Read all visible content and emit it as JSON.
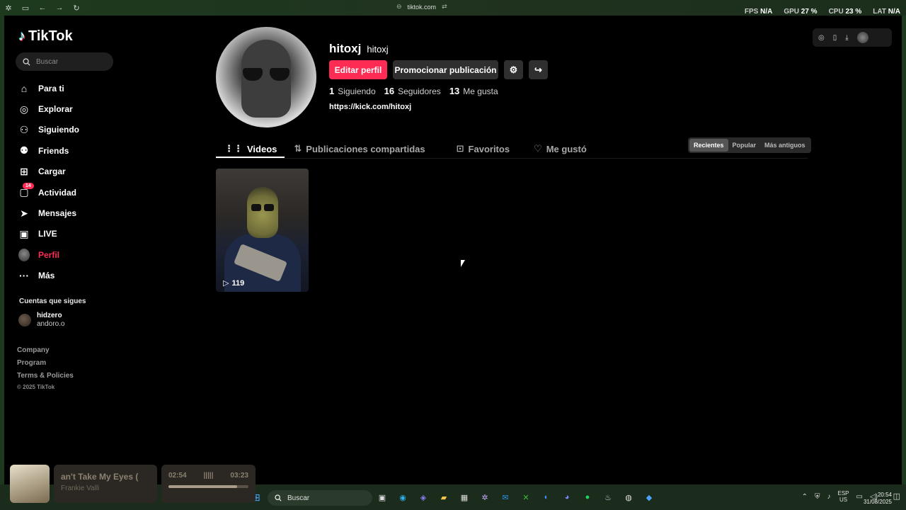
{
  "browser": {
    "url": "tiktok.com"
  },
  "overlay": {
    "fps_label": "FPS",
    "fps_value": "N/A",
    "gpu_label": "GPU",
    "gpu_value": "27 %",
    "cpu_label": "CPU",
    "cpu_value": "23 %",
    "lat_label": "LAT",
    "lat_value": "N/A"
  },
  "sidebar": {
    "logo": "TikTok",
    "search_placeholder": "Buscar",
    "items": [
      {
        "label": "Para ti",
        "icon": "home-icon"
      },
      {
        "label": "Explorar",
        "icon": "compass-icon"
      },
      {
        "label": "Siguiendo",
        "icon": "following-icon"
      },
      {
        "label": "Friends",
        "icon": "friends-icon"
      },
      {
        "label": "Cargar",
        "icon": "upload-icon"
      },
      {
        "label": "Actividad",
        "icon": "inbox-icon",
        "badge": "14"
      },
      {
        "label": "Mensajes",
        "icon": "send-icon"
      },
      {
        "label": "LIVE",
        "icon": "live-icon"
      },
      {
        "label": "Perfil",
        "icon": "avatar",
        "active": true
      },
      {
        "label": "Más",
        "icon": "more-icon"
      }
    ],
    "following_title": "Cuentas que sigues",
    "following": [
      {
        "name": "hidzero",
        "handle": "andoro.o"
      }
    ],
    "footer": [
      "Company",
      "Program",
      "Terms & Policies"
    ],
    "copyright": "© 2025 TikTok"
  },
  "profile": {
    "username": "hitoxj",
    "nickname": "hitoxj",
    "edit_label": "Editar perfil",
    "promote_label": "Promocionar publicación",
    "stats": [
      {
        "value": "1",
        "label": "Siguiendo"
      },
      {
        "value": "16",
        "label": "Seguidores"
      },
      {
        "value": "13",
        "label": "Me gusta"
      }
    ],
    "link": "https://kick.com/hitoxj"
  },
  "tabs": [
    {
      "label": "Videos",
      "active": true
    },
    {
      "label": "Publicaciones compartidas"
    },
    {
      "label": "Favoritos"
    },
    {
      "label": "Me gustó"
    }
  ],
  "sort": [
    "Recientes",
    "Popular",
    "Más antiguos"
  ],
  "videos": [
    {
      "views": "119"
    }
  ],
  "music": {
    "title": "an't Take My Eyes (",
    "artist": "Frankie Valli",
    "current": "02:54",
    "total": "03:23",
    "progress": 0.86
  },
  "taskbar": {
    "search": "Buscar",
    "lang1": "ESP",
    "lang2": "US",
    "time": "20:54",
    "date": "31/08/2025"
  }
}
